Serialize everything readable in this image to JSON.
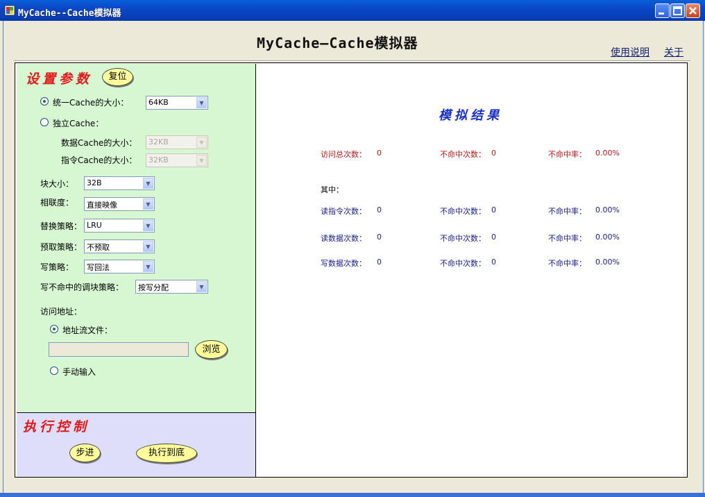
{
  "window": {
    "title": "MyCache--Cache模拟器"
  },
  "app_title": "MyCache—Cache模拟器",
  "links": {
    "help": "使用说明",
    "about": "关于"
  },
  "settings": {
    "title": "设置参数",
    "reset_label": "复位",
    "unified_cache_label": "统一Cache的大小：",
    "unified_cache_value": "64KB",
    "unified_selected": true,
    "split_cache_label": "独立Cache：",
    "data_cache_label": "数据Cache的大小：",
    "data_cache_value": "32KB",
    "inst_cache_label": "指令Cache的大小：",
    "inst_cache_value": "32KB",
    "block_size_label": "块大小：",
    "block_size_value": "32B",
    "assoc_label": "相联度：",
    "assoc_value": "直接映像",
    "replace_label": "替换策略：",
    "replace_value": "LRU",
    "prefetch_label": "预取策略：",
    "prefetch_value": "不预取",
    "write_label": "写策略：",
    "write_value": "写回法",
    "write_miss_label": "写不命中的调块策略：",
    "write_miss_value": "按写分配",
    "address_label": "访问地址：",
    "address_file_label": "地址流文件：",
    "address_file_value": "",
    "browse_label": "浏览",
    "manual_label": "手动输入",
    "file_selected": true
  },
  "exec": {
    "title": "执行控制",
    "step_label": "步进",
    "run_label": "执行到底"
  },
  "results": {
    "title": "模拟结果",
    "total": {
      "label": "访问总次数：",
      "value": "0",
      "miss_label": "不命中次数：",
      "miss_value": "0",
      "rate_label": "不命中率：",
      "rate_value": "0.00%"
    },
    "sub_label": "其中：",
    "rows": [
      {
        "label": "读指令次数：",
        "value": "0",
        "miss_label": "不命中次数：",
        "miss_value": "0",
        "rate_label": "不命中率：",
        "rate_value": "0.00%"
      },
      {
        "label": "读数据次数：",
        "value": "0",
        "miss_label": "不命中次数：",
        "miss_value": "0",
        "rate_label": "不命中率：",
        "rate_value": "0.00%"
      },
      {
        "label": "写数据次数：",
        "value": "0",
        "miss_label": "不命中次数：",
        "miss_value": "0",
        "rate_label": "不命中率：",
        "rate_value": "0.00%"
      }
    ]
  },
  "colors": {
    "settings_bg": "#d7f7d3",
    "exec_bg": "#dedefa",
    "section_title": "#e0191b",
    "result_title": "#1a31c4",
    "button_fill": "#ffff9c"
  }
}
